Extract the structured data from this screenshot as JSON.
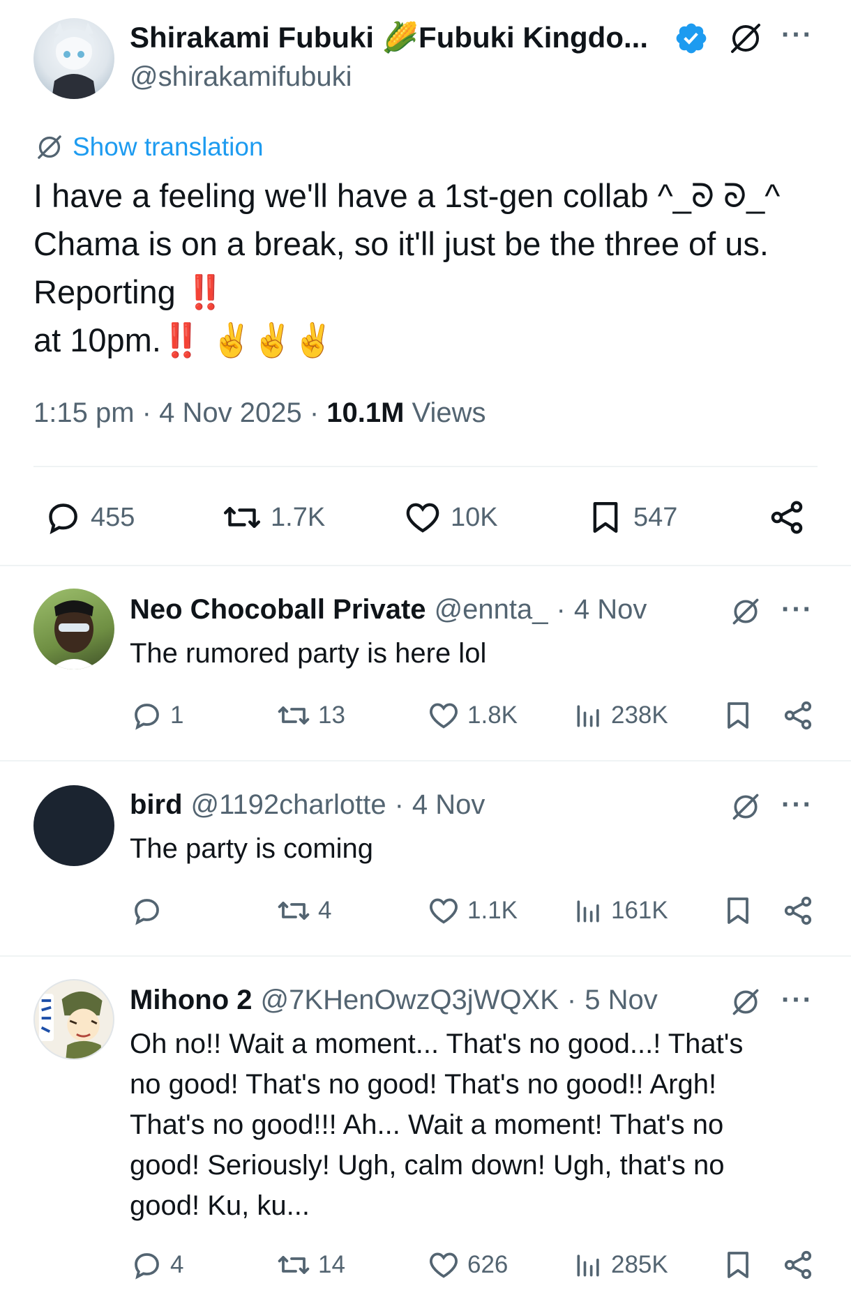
{
  "main_tweet": {
    "display_name": "Shirakami Fubuki 🌽Fubuki Kingdo...",
    "handle": "@shirakamifubuki",
    "translate_label": "Show translation",
    "lines": [
      "I have a feeling we'll have a 1st-gen collab ^_ᘐ ᘐ_^",
      "Chama is on a break, so it'll just be the three of us.",
      "Reporting ‼️",
      "at 10pm.‼️ ✌️✌️✌️"
    ],
    "time": "1:15 pm",
    "date": "4 Nov 2025",
    "views_count": "10.1M",
    "views_label": "Views",
    "replies": "455",
    "reposts": "1.7K",
    "likes": "10K",
    "bookmarks": "547"
  },
  "replies": [
    {
      "name": "Neo Chocoball Private",
      "handle": "@ennta_",
      "date": "4 Nov",
      "text": "The rumored party is here lol",
      "reply_count": "1",
      "repost_count": "13",
      "like_count": "1.8K",
      "view_count": "238K"
    },
    {
      "name": "bird",
      "handle": "@1192charlotte",
      "date": "4 Nov",
      "text": "The party is coming",
      "reply_count": "",
      "repost_count": "4",
      "like_count": "1.1K",
      "view_count": "161K"
    },
    {
      "name": "Mihono 2",
      "handle": "@7KHenOwzQ3jWQXK",
      "date": "5 Nov",
      "text_lines": [
        "Oh no!! Wait a moment... That's no good...! That's",
        "no good! That's no good! That's no good!! Argh!",
        "That's no good!!! Ah... Wait a moment! That's no",
        "good! Seriously! Ugh, calm down! Ugh, that's no",
        "good! Ku, ku..."
      ],
      "reply_count": "4",
      "repost_count": "14",
      "like_count": "626",
      "view_count": "285K"
    }
  ],
  "colors": {
    "text": "#0f1419",
    "secondary": "#536471",
    "link": "#1d9bf0",
    "verified": "#1d9bf0",
    "divider": "#eff3f4"
  },
  "icons": [
    "grok-icon",
    "more-icon",
    "verified-icon",
    "reply-icon",
    "repost-icon",
    "like-icon",
    "bookmark-icon",
    "share-icon",
    "views-icon",
    "translate-icon"
  ]
}
